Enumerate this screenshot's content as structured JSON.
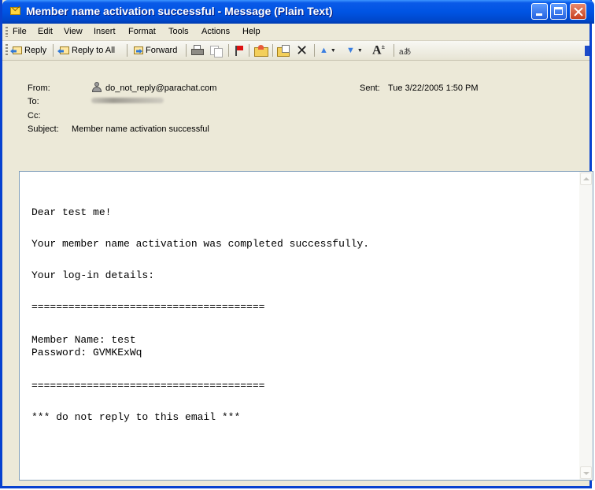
{
  "window": {
    "title": "Member name activation successful - Message (Plain Text)"
  },
  "menubar": {
    "items": [
      {
        "label": "File"
      },
      {
        "label": "Edit"
      },
      {
        "label": "View"
      },
      {
        "label": "Insert"
      },
      {
        "label": "Format"
      },
      {
        "label": "Tools"
      },
      {
        "label": "Actions"
      },
      {
        "label": "Help"
      }
    ]
  },
  "toolbar": {
    "reply_label": "Reply",
    "reply_all_label": "Reply to All",
    "forward_label": "Forward",
    "icons": [
      "reply-icon",
      "reply-all-icon",
      "forward-icon",
      "print-icon",
      "copy-icon",
      "flag-icon",
      "folder-icon",
      "move-icon",
      "delete-icon",
      "previous-item-icon",
      "next-item-icon",
      "font-size-icon",
      "encoding-icon"
    ]
  },
  "header": {
    "from_label": "From:",
    "from_value": "do_not_reply@parachat.com",
    "to_label": "To:",
    "cc_label": "Cc:",
    "subject_label": "Subject:",
    "subject_value": "Member name activation successful",
    "sent_label": "Sent:",
    "sent_value": "Tue 3/22/2005 1:50 PM"
  },
  "body": {
    "greeting": "Dear test me!",
    "line1": "Your member name activation was completed successfully.",
    "line2": "Your log-in details:",
    "separator1": "======================================",
    "member_name": "Member Name: test",
    "password": "Password: GVMKExWq",
    "separator2": "======================================",
    "footer": "*** do not reply to this email ***"
  },
  "colors": {
    "titlebar": "#0054e3",
    "window_border": "#0842d0",
    "chrome": "#ece9d8",
    "body_bg": "#ffffff"
  }
}
